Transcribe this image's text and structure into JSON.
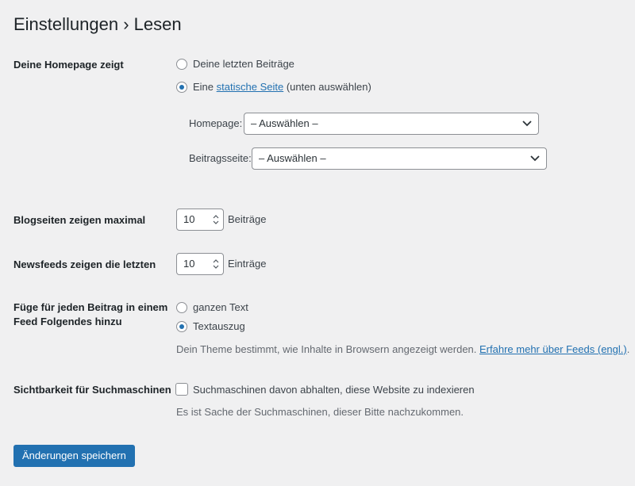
{
  "page": {
    "title": "Einstellungen › Lesen"
  },
  "homepage_section": {
    "label": "Deine Homepage zeigt",
    "option_latest": "Deine letzten Beiträge",
    "option_static_prefix": "Eine",
    "option_static_link": "statische Seite",
    "option_static_suffix": "(unten auswählen)",
    "selected": "static",
    "homepage_label": "Homepage:",
    "homepage_value": "– Auswählen –",
    "postspage_label": "Beitragsseite:",
    "postspage_value": "– Auswählen –"
  },
  "blog_pages": {
    "label": "Blogseiten zeigen maximal",
    "value": "10",
    "unit": "Beiträge"
  },
  "feeds": {
    "label": "Newsfeeds zeigen die letzten",
    "value": "10",
    "unit": "Einträge"
  },
  "feed_content": {
    "label_line1": "Füge für jeden Beitrag in einem",
    "label_line2": "Feed Folgendes hinzu",
    "option_full": "ganzen Text",
    "option_excerpt": "Textauszug",
    "selected": "excerpt",
    "description": "Dein Theme bestimmt, wie Inhalte in Browsern angezeigt werden.",
    "description_link": "Erfahre mehr über Feeds (engl.)",
    "description_end": "."
  },
  "search_visibility": {
    "label": "Sichtbarkeit für Suchmaschinen",
    "checkbox_label": "Suchmaschinen davon abhalten, diese Website zu indexieren",
    "checked": false,
    "description": "Es ist Sache der Suchmaschinen, dieser Bitte nachzukommen."
  },
  "submit": {
    "label": "Änderungen speichern"
  },
  "colors": {
    "accent": "#2271b1",
    "background": "#f0f0f1",
    "text": "#1d2327"
  }
}
